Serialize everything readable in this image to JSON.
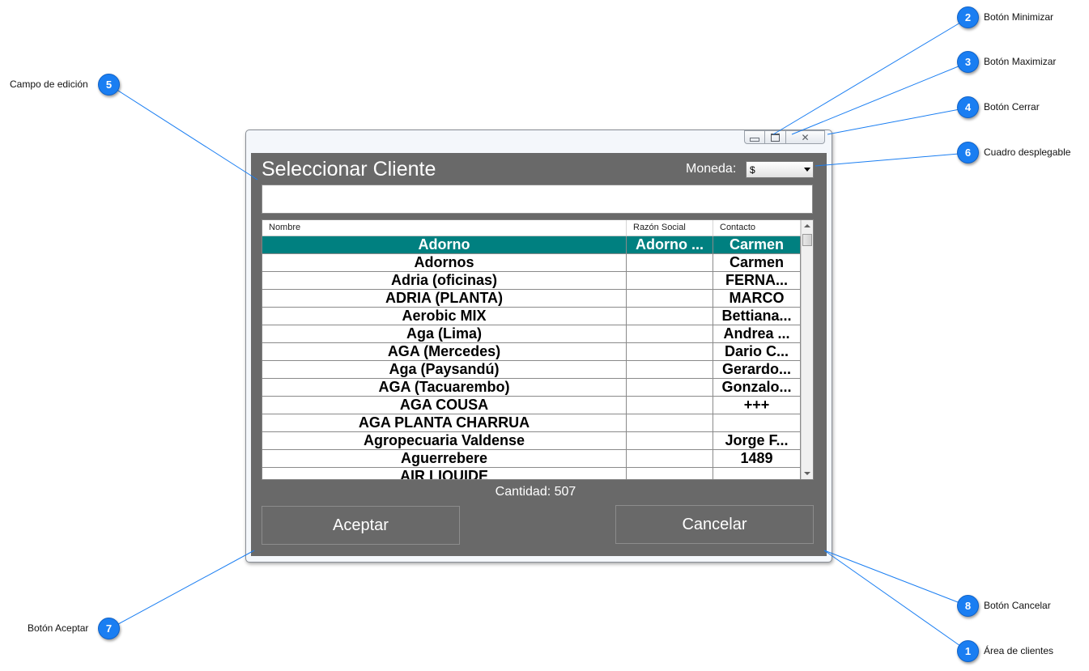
{
  "dialog": {
    "title": "Seleccionar Cliente",
    "currency_label": "Moneda:",
    "currency_value": "$",
    "search_value": "",
    "columns": [
      "Nombre",
      "Razón Social",
      "Contacto"
    ],
    "rows": [
      {
        "nombre": "Adorno",
        "razon": "Adorno ...",
        "contacto": "Carmen",
        "selected": true
      },
      {
        "nombre": "Adornos",
        "razon": "",
        "contacto": "Carmen"
      },
      {
        "nombre": "Adria (oficinas)",
        "razon": "",
        "contacto": "FERNA..."
      },
      {
        "nombre": "ADRIA (PLANTA)",
        "razon": "",
        "contacto": "MARCO"
      },
      {
        "nombre": "Aerobic MIX",
        "razon": "",
        "contacto": "Bettiana..."
      },
      {
        "nombre": "Aga (Lima)",
        "razon": "",
        "contacto": "Andrea ..."
      },
      {
        "nombre": "AGA (Mercedes)",
        "razon": "",
        "contacto": "Dario C..."
      },
      {
        "nombre": "Aga (Paysandú)",
        "razon": "",
        "contacto": "Gerardo..."
      },
      {
        "nombre": "AGA (Tacuarembo)",
        "razon": "",
        "contacto": "Gonzalo..."
      },
      {
        "nombre": "AGA COUSA",
        "razon": "",
        "contacto": "+++"
      },
      {
        "nombre": "AGA PLANTA CHARRUA",
        "razon": "",
        "contacto": ""
      },
      {
        "nombre": "Agropecuaria Valdense",
        "razon": "",
        "contacto": "Jorge F..."
      },
      {
        "nombre": "Aguerrebere",
        "razon": "",
        "contacto": "1489"
      },
      {
        "nombre": "AIR LIQUIDE",
        "razon": "",
        "contacto": ""
      }
    ],
    "count_text": "Cantidad: 507",
    "accept_label": "Aceptar",
    "cancel_label": "Cancelar",
    "selected_row_color": "#008080",
    "panel_color": "#696969"
  },
  "callouts": [
    {
      "number": "1",
      "label": "Área de clientes"
    },
    {
      "number": "2",
      "label": "Botón Minimizar"
    },
    {
      "number": "3",
      "label": "Botón Maximizar"
    },
    {
      "number": "4",
      "label": "Botón Cerrar"
    },
    {
      "number": "5",
      "label": "Campo de edición"
    },
    {
      "number": "6",
      "label": "Cuadro desplegable"
    },
    {
      "number": "7",
      "label": "Botón Aceptar"
    },
    {
      "number": "8",
      "label": "Botón Cancelar"
    }
  ],
  "callout_color": "#1a7ef2"
}
